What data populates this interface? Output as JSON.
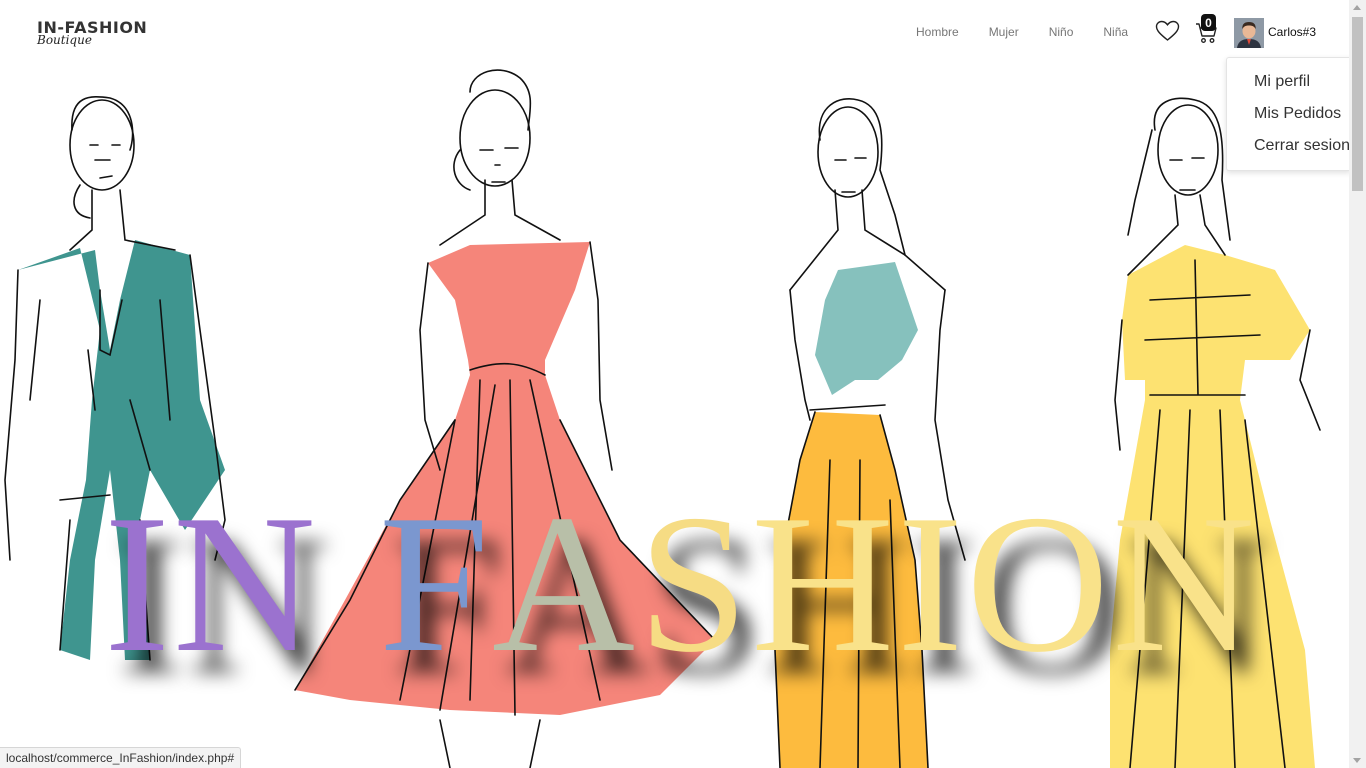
{
  "brand": {
    "name": "IN-FASHION",
    "tagline": "Boutique"
  },
  "nav": {
    "items": [
      "Hombre",
      "Mujer",
      "Niño",
      "Niña"
    ]
  },
  "header": {
    "wishlist_icon": "heart-icon",
    "cart_icon": "cart-icon",
    "cart_count": "0",
    "username": "Carlos#3"
  },
  "user_menu": {
    "items": [
      "Mi perfil",
      "Mis Pedidos",
      "Cerrar sesion"
    ]
  },
  "hero": {
    "title_letters": [
      "I",
      "N",
      " ",
      "F",
      "A",
      "S",
      "H",
      "I",
      "O",
      "N"
    ],
    "letter_colors": [
      "#9b72cf",
      "#9b72cf",
      "",
      "#7b97cf",
      "#b8bfa8",
      "#f6dc84",
      "#f9e28a",
      "#f9e28a",
      "#f9e28a",
      "#f9e28a"
    ],
    "figure_colors": {
      "suit": "#3f958f",
      "dress": "#f5857a",
      "top": "#86c1bd",
      "skirt": "#fdbb3e",
      "yellow_dress": "#fde271"
    }
  },
  "status": {
    "url": "localhost/commerce_InFashion/index.php#"
  }
}
